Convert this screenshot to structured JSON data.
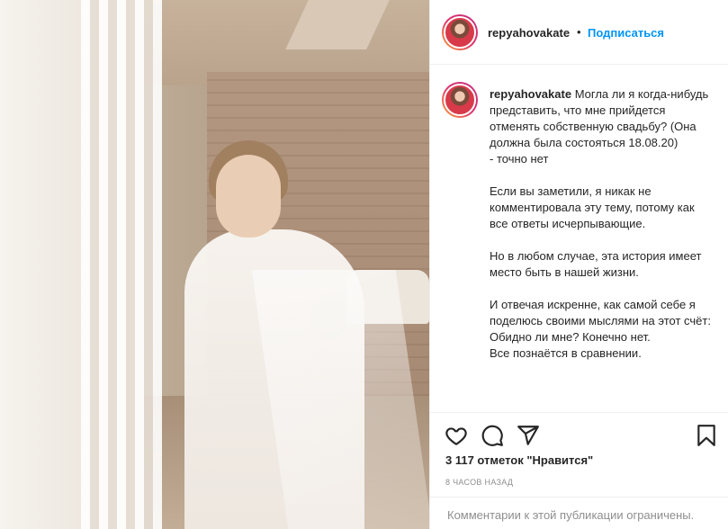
{
  "post": {
    "photo_alt": "",
    "header": {
      "username": "repyahovakate",
      "separator": "•",
      "follow_label": "Подписаться"
    },
    "caption": {
      "author": "repyahovakate",
      "text": "Могла ли я когда-нибудь представить, что мне прийдется отменять собственную свадьбу? (Она должна была состояться 18.08.20)\n- точно нет\n\nЕсли вы заметили, я никак не комментировала эту тему, потому как все ответы исчерпывающие.\n\nНо в любом случае, эта история имеет место быть в нашей жизни.\n\nИ отвечая искренне, как самой себе я поделюсь своими мыслями на этот счёт:\nОбидно ли мне? Конечно нет.\nВсе познаётся в сравнении."
    },
    "actions": {
      "like_icon": "heart-icon",
      "comment_icon": "comment-icon",
      "share_icon": "share-icon",
      "save_icon": "bookmark-icon"
    },
    "likes_text": "3 117 отметок \"Нравится\"",
    "time_text": "8 ЧАСОВ НАЗАД",
    "comments_disabled_text": "Комментарии к этой публикации ограничены."
  },
  "colors": {
    "accent": "#0095f6",
    "text": "#262626",
    "muted": "#8e8e8e",
    "divider": "#efefef"
  }
}
